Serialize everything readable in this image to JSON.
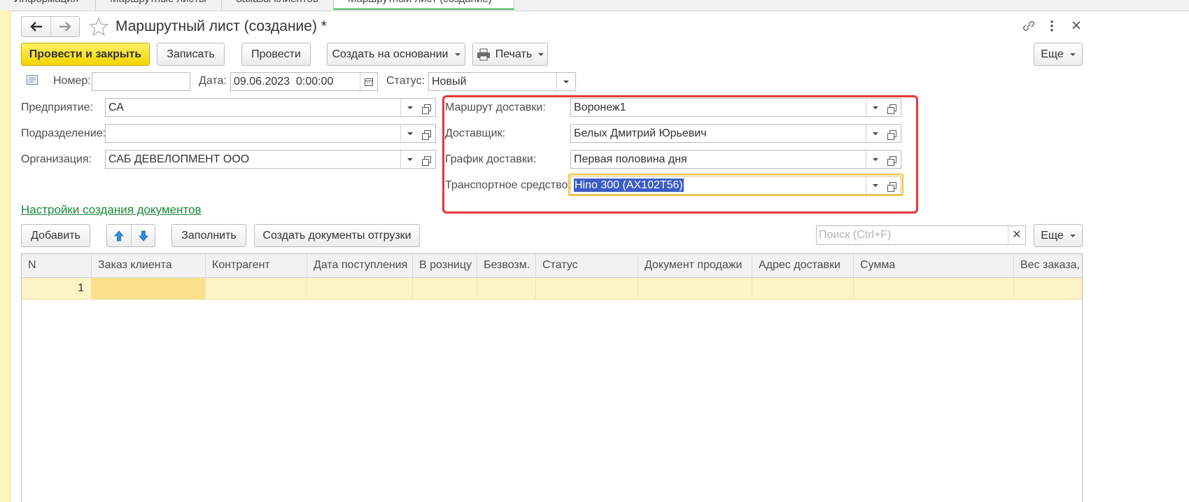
{
  "tabs": [
    {
      "label": "Информация"
    },
    {
      "label": "Маршрутные листы"
    },
    {
      "label": "Заказы клиентов"
    },
    {
      "label": "Маршрутный лист (создание)"
    }
  ],
  "window": {
    "title": "Маршрутный лист (создание) *"
  },
  "toolbar": {
    "post_and_close": "Провести и закрыть",
    "save": "Записать",
    "post": "Провести",
    "create_based_on": "Создать на основании",
    "print": "Печать",
    "more": "Еще"
  },
  "header": {
    "number_label": "Номер:",
    "number_value": "",
    "date_label": "Дата:",
    "date_value": "09.06.2023  0:00:00",
    "status_label": "Статус:",
    "status_value": "Новый"
  },
  "left_fields": {
    "enterprise_label": "Предприятие:",
    "enterprise_value": "СА",
    "division_label": "Подразделение:",
    "division_value": "",
    "organization_label": "Организация:",
    "organization_value": "САБ ДЕВЕЛОПМЕНТ ООО"
  },
  "right_fields": {
    "route_label": "Маршрут доставки:",
    "route_value": "Воронеж1",
    "carrier_label": "Доставщик:",
    "carrier_value": "Белых Дмитрий Юрьевич",
    "schedule_label": "График доставки:",
    "schedule_value": "Первая половина дня",
    "vehicle_label": "Транспортное средство:",
    "vehicle_value": "Hino 300 (АХ102Т56)"
  },
  "colors": {
    "highlight_border": "#e53935",
    "primary_button": "#f4d400",
    "link_green": "#1a8a3a",
    "selected_row": "#fdf3c6",
    "selection_bg": "#3b5cc6"
  },
  "settings_link": "Настройки создания документов",
  "table_toolbar": {
    "add": "Добавить",
    "fill": "Заполнить",
    "create_shipments": "Создать документы отгрузки",
    "search_placeholder": "Поиск (Ctrl+F)",
    "more": "Еще"
  },
  "table": {
    "columns": [
      "N",
      "Заказ клиента",
      "Контрагент",
      "Дата поступления",
      "В розницу",
      "Безвозм.",
      "Статус",
      "Документ продажи",
      "Адрес доставки",
      "Сумма",
      "Вес заказа,"
    ],
    "rows": [
      {
        "n": "1"
      }
    ]
  }
}
